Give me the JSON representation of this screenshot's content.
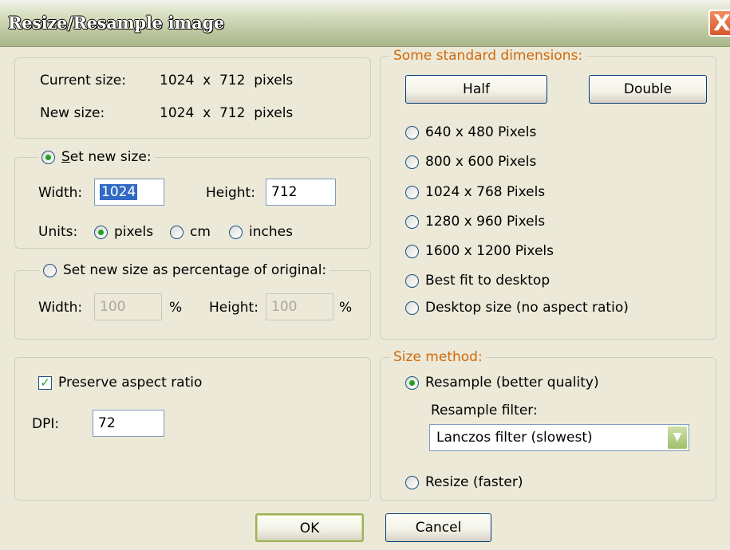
{
  "window": {
    "title": "Resize/Resample image",
    "close_label": "X"
  },
  "info": {
    "current_label": "Current size:",
    "current_value": "1024  x  712  pixels",
    "new_label": "New size:",
    "new_value": "1024  x  712  pixels"
  },
  "set_size": {
    "legend": "Set new size:",
    "width_label": "Width:",
    "width_value": "1024",
    "height_label": "Height:",
    "height_value": "712",
    "units_label": "Units:",
    "units": [
      "pixels",
      "cm",
      "inches"
    ],
    "selected_unit": "pixels"
  },
  "percent": {
    "legend": "Set new size as percentage of original:",
    "width_label": "Width:",
    "width_value": "100",
    "height_label": "Height:",
    "height_value": "100",
    "pct": "%"
  },
  "aspect": {
    "preserve_label": "Preserve aspect ratio",
    "checked": true,
    "dpi_label": "DPI:",
    "dpi_value": "72"
  },
  "standard": {
    "legend": "Some standard dimensions:",
    "half_label": "Half",
    "double_label": "Double",
    "options": [
      "640 x 480 Pixels",
      "800 x 600 Pixels",
      "1024 x 768 Pixels",
      "1280 x 960 Pixels",
      "1600 x 1200 Pixels",
      "Best fit to desktop",
      "Desktop size (no aspect ratio)"
    ]
  },
  "method": {
    "legend": "Size method:",
    "resample_label": "Resample (better quality)",
    "filter_label": "Resample filter:",
    "filter_value": "Lanczos filter (slowest)",
    "resize_label": "Resize (faster)",
    "selected": "resample"
  },
  "footer": {
    "ok_label": "OK",
    "cancel_label": "Cancel"
  },
  "colors": {
    "accent_orange": "#d0690a",
    "check_green": "#21a121"
  }
}
